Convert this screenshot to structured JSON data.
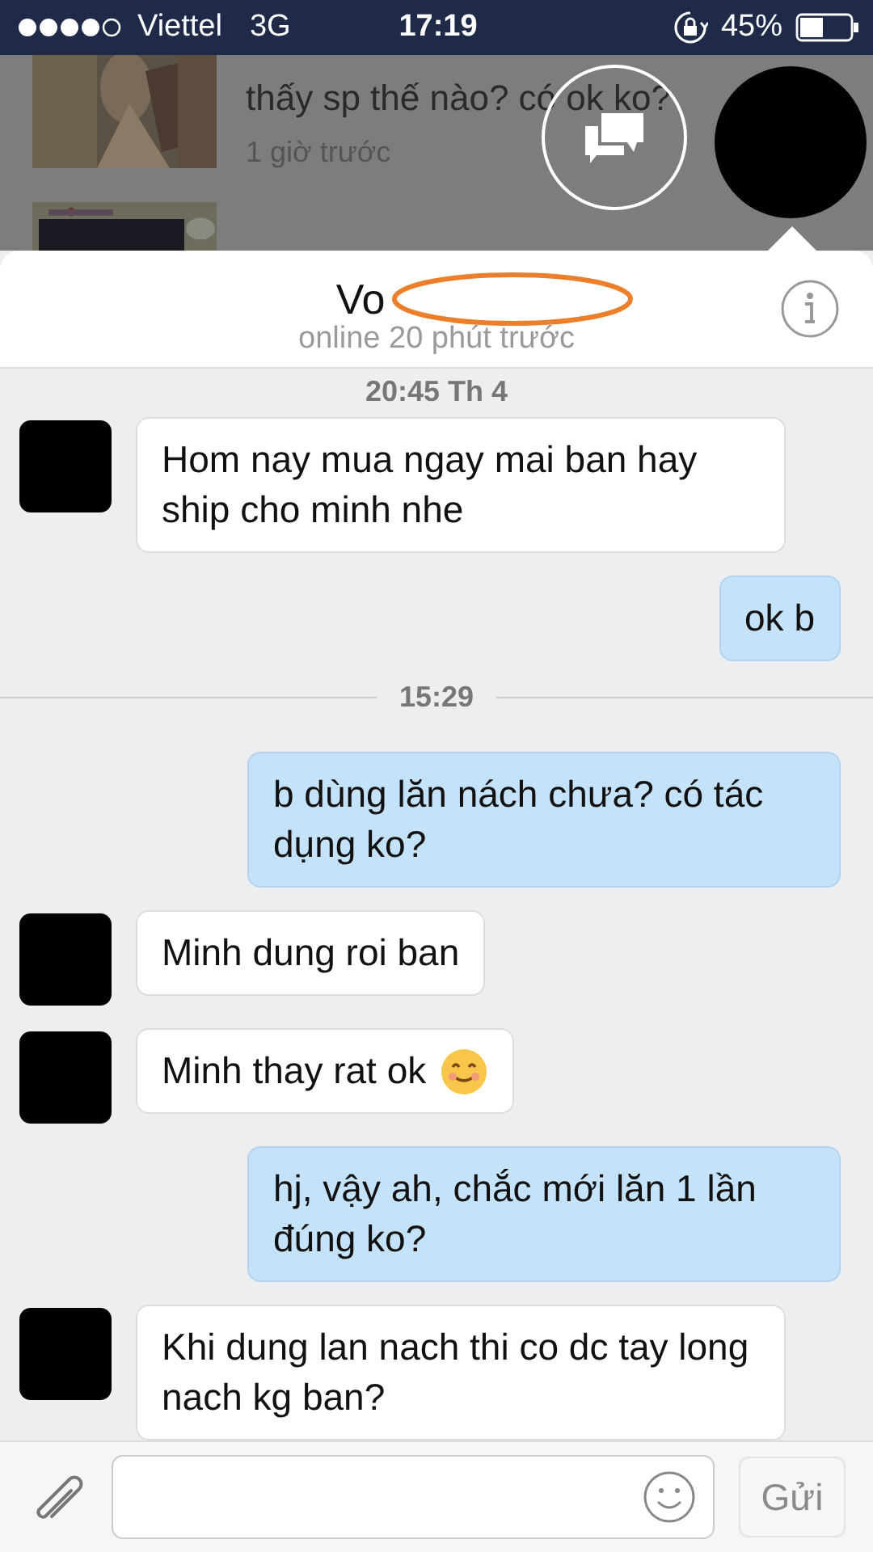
{
  "status_bar": {
    "carrier": "Viettel",
    "network": "3G",
    "time": "17:19",
    "battery": "45%"
  },
  "background_list": {
    "preview": "thấy sp thế nào? có ok ko?",
    "time": "1 giờ trước"
  },
  "chat_header": {
    "name": "Vo",
    "status": "online 20 phút trước"
  },
  "messages": [
    {
      "kind": "separator",
      "text": "20:45 Th 4"
    },
    {
      "kind": "incoming",
      "text": "Hom nay mua ngay mai ban hay ship cho minh nhe",
      "emoji": false
    },
    {
      "kind": "outgoing",
      "text": "ok b",
      "emoji": false
    },
    {
      "kind": "separator",
      "text": "15:29"
    },
    {
      "kind": "outgoing",
      "text": "b dùng lăn nách chưa? có tác dụng ko?",
      "emoji": false
    },
    {
      "kind": "incoming",
      "text": "Minh dung roi ban",
      "emoji": false
    },
    {
      "kind": "incoming",
      "text": "Minh thay rat ok",
      "emoji": true
    },
    {
      "kind": "outgoing",
      "text": "hj, vậy ah, chắc mới lăn 1 lần đúng ko?",
      "emoji": false
    },
    {
      "kind": "incoming",
      "text": "Khi dung lan nach thi co dc tay long nach kg ban?",
      "emoji": false
    }
  ],
  "composer": {
    "send": "Gửi",
    "send_disabled": true
  }
}
